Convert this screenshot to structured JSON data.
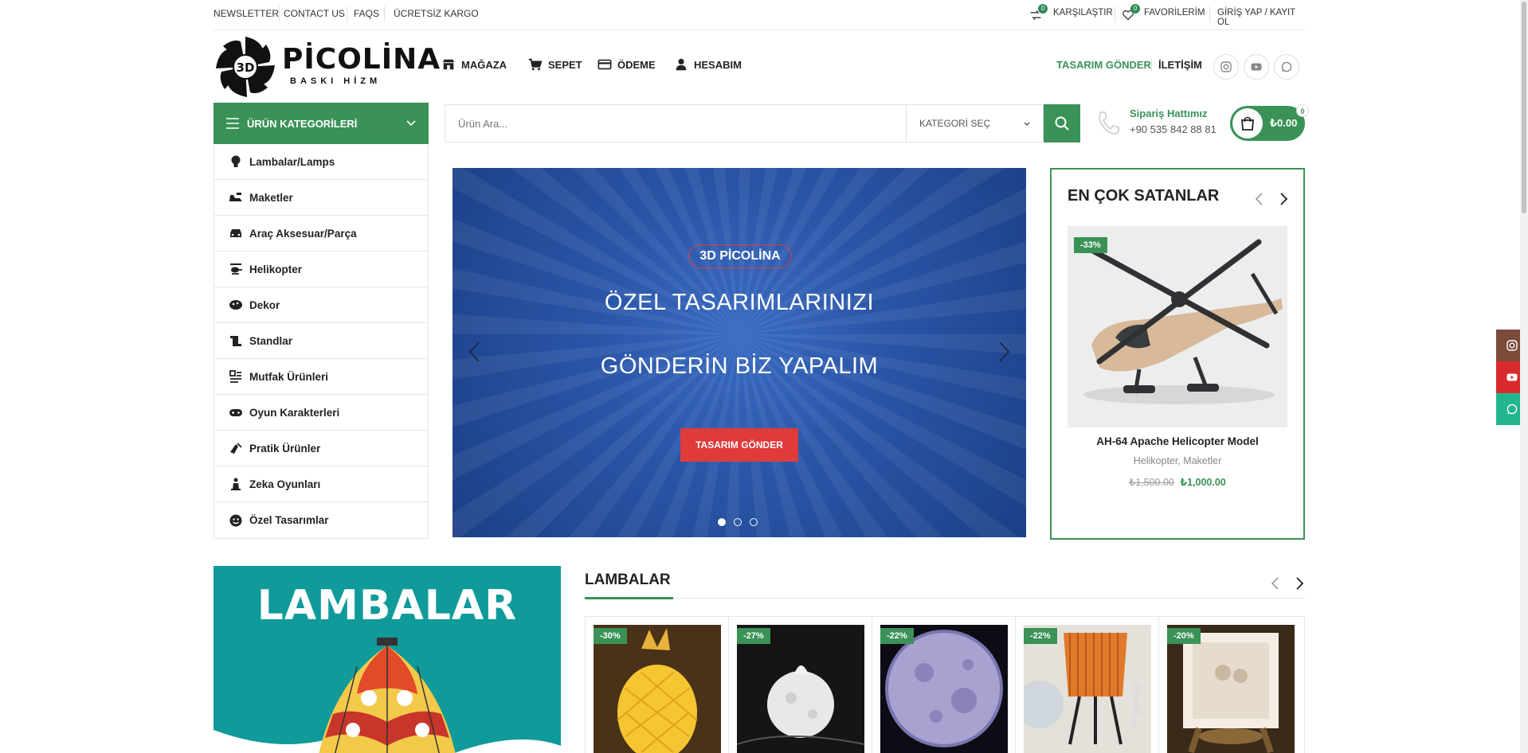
{
  "topbar": {
    "links": [
      "NEWSLETTER",
      "CONTACT US",
      "FAQS",
      "ÜCRETSİZ KARGO"
    ],
    "compare_label": "KARŞILAŞTIR",
    "compare_count": "0",
    "favorites_label": "FAVORİLERİM",
    "favorites_count": "0",
    "login_label": "GİRİŞ YAP / KAYIT OL"
  },
  "logo": {
    "title": "PİCOLİNA",
    "subtitle": "BASKI HİZM",
    "mark": "3D"
  },
  "nav": {
    "items": [
      "MAĞAZA",
      "SEPET",
      "ÖDEME",
      "HESABIM"
    ],
    "design_link": "TASARIM GÖNDER",
    "contact_link": "İLETİŞİM"
  },
  "categories": {
    "header": "ÜRÜN KATEGORİLERİ",
    "items": [
      "Lambalar/Lamps",
      "Maketler",
      "Araç Aksesuar/Parça",
      "Helikopter",
      "Dekor",
      "Standlar",
      "Mutfak Ürünleri",
      "Oyun Karakterleri",
      "Pratik Ürünler",
      "Zeka Oyunları",
      "Özel Tasarımlar"
    ]
  },
  "search": {
    "placeholder": "Ürün Ara...",
    "category_select": "KATEGORİ SEÇ"
  },
  "hotline": {
    "title": "Sipariş Hattımız",
    "number": "+90 535 842 88 81"
  },
  "cart": {
    "amount": "₺0.00",
    "count": "0"
  },
  "hero": {
    "tag": "3D PİCOLİNA",
    "line1": "ÖZEL TASARIMLARINIZI",
    "line2": "GÖNDERİN BİZ YAPALIM",
    "button": "TASARIM GÖNDER",
    "active_slide": 1,
    "slide_count": 3
  },
  "best_sellers": {
    "title": "EN ÇOK SATANLAR",
    "product": {
      "discount": "-33%",
      "name": "AH-64 Apache Helicopter Model",
      "categories": "Helikopter, Maketler",
      "old_price": "₺1,500.00",
      "new_price": "₺1,000.00"
    }
  },
  "lamps_section": {
    "banner_text": "LAMBALAR",
    "title": "LAMBALAR",
    "products": [
      {
        "discount": "-30%"
      },
      {
        "discount": "-27%"
      },
      {
        "discount": "-22%"
      },
      {
        "discount": "-22%"
      },
      {
        "discount": "-20%"
      }
    ]
  },
  "colors": {
    "accent": "#3a9257",
    "hero_blue": "#2a56a8",
    "hero_button": "#e03a3a",
    "instagram": "#7b4a3a",
    "youtube": "#d92b2b",
    "whatsapp": "#22b58e",
    "banner_teal": "#109a9a"
  },
  "icons": {
    "topbar": [
      "compare-icon",
      "heart-icon"
    ],
    "nav": [
      "store-icon",
      "cart-icon",
      "card-icon",
      "user-icon"
    ],
    "social": [
      "instagram-icon",
      "youtube-icon",
      "whatsapp-icon"
    ]
  }
}
